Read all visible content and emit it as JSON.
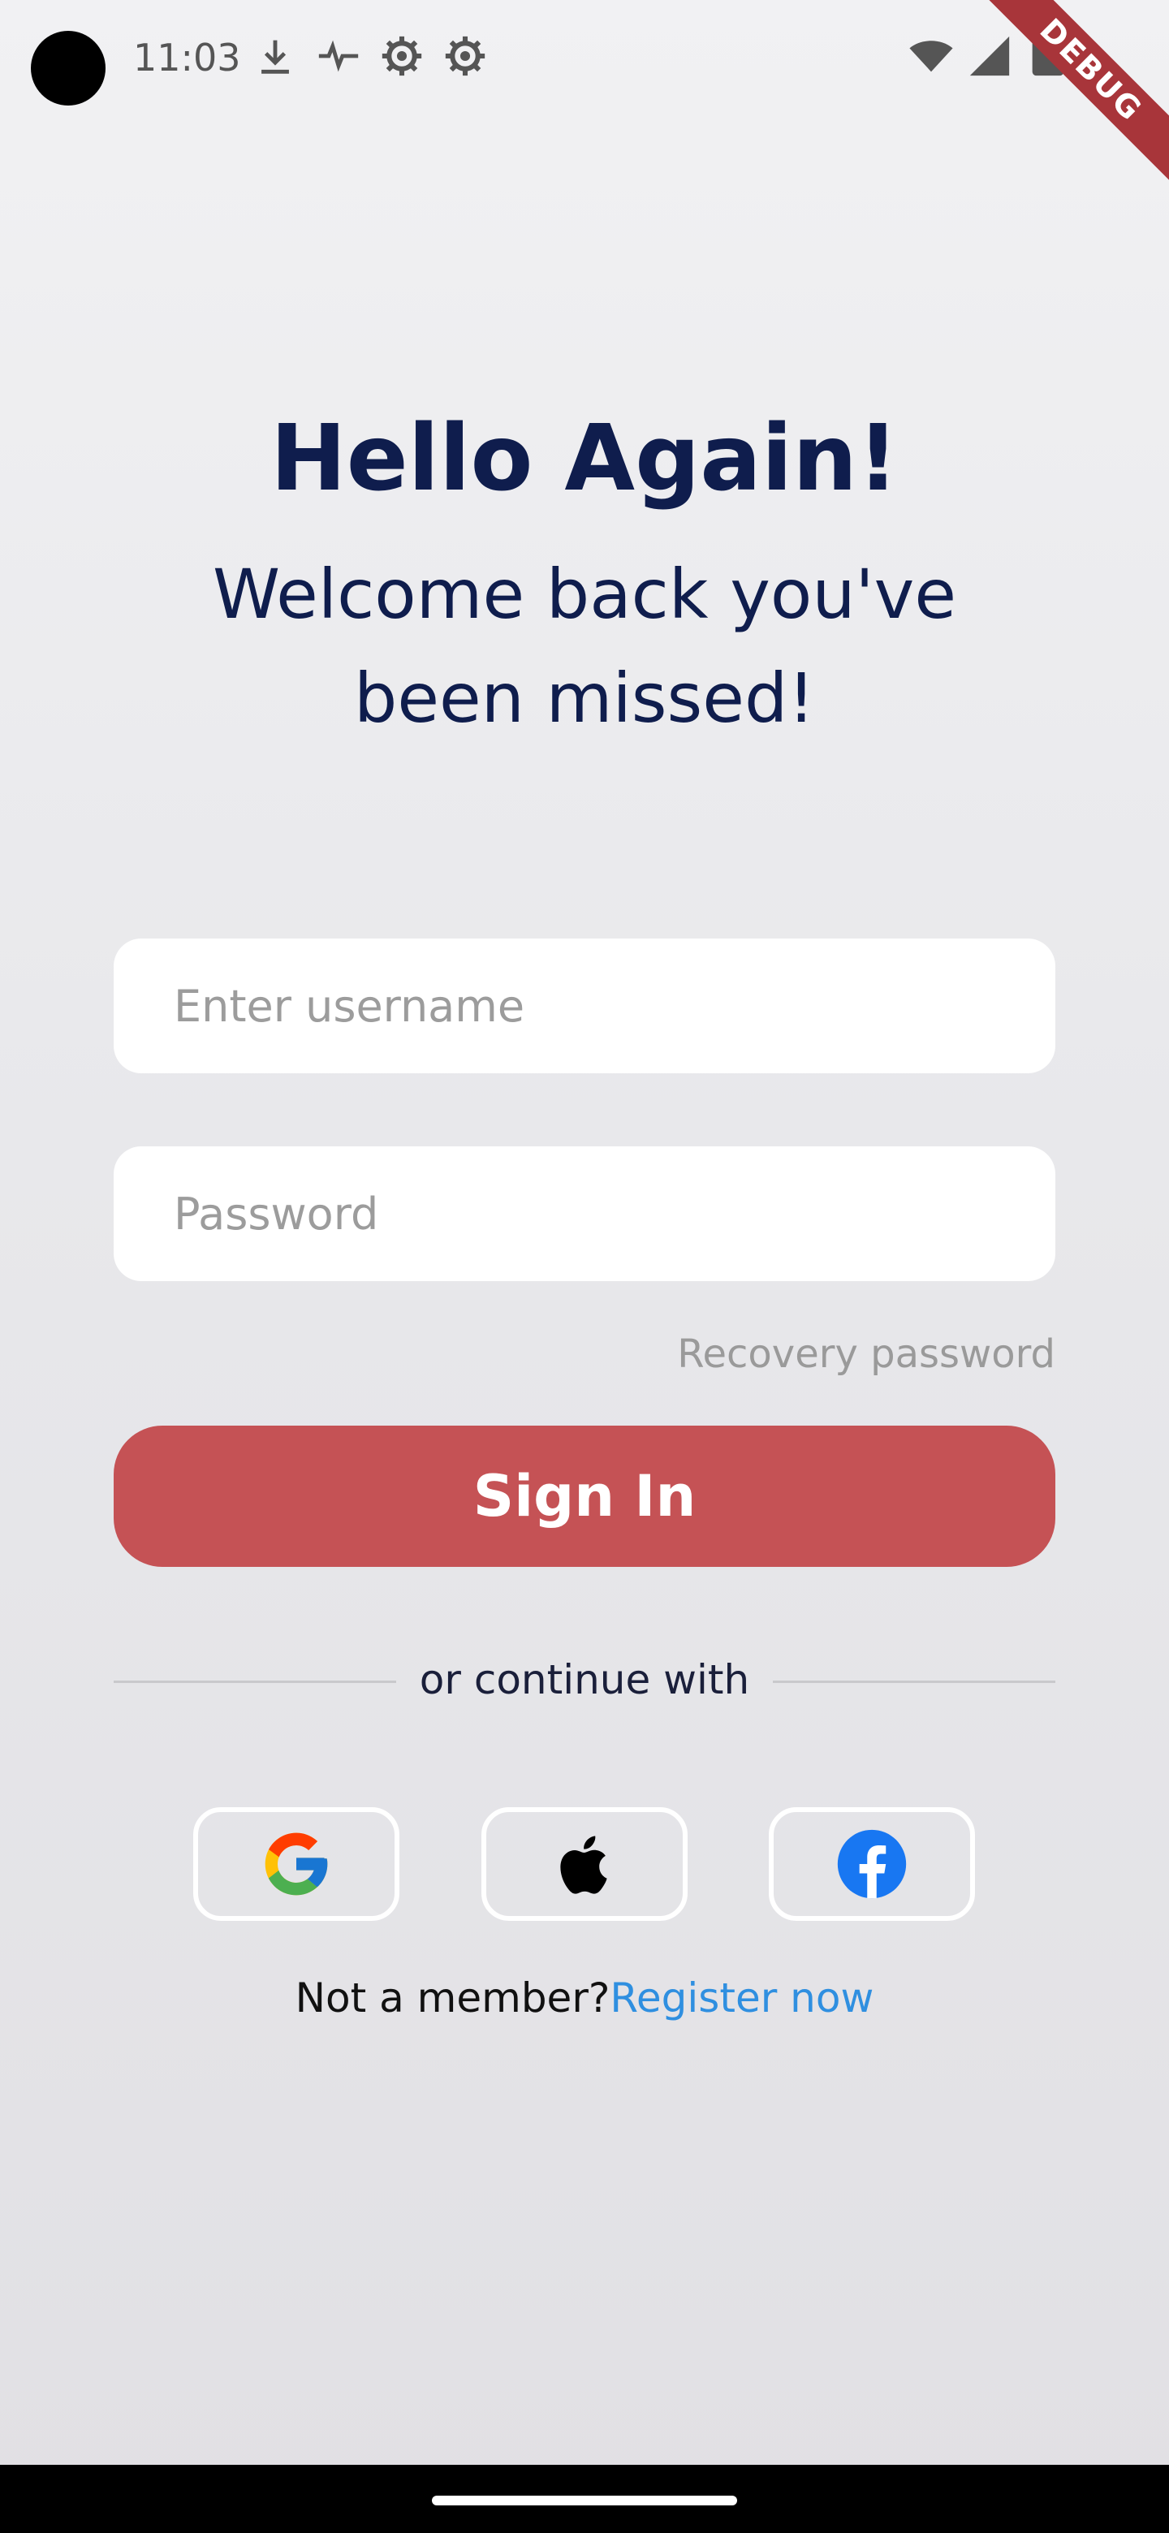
{
  "status_bar": {
    "time": "11:03",
    "left_icons": [
      "download-icon",
      "activity-icon",
      "gear-icon",
      "gear-icon"
    ],
    "right_icons": [
      "wifi-icon",
      "cellular-signal-icon",
      "battery-icon"
    ]
  },
  "debug_banner": "DEBUG",
  "header": {
    "title": "Hello Again!",
    "subtitle": "Welcome back you've been missed!"
  },
  "form": {
    "username_placeholder": "Enter username",
    "password_placeholder": "Password",
    "recovery_label": "Recovery password",
    "sign_in_label": "Sign In"
  },
  "divider_text": "or continue with",
  "social": [
    {
      "name": "Google",
      "icon": "google-icon"
    },
    {
      "name": "Apple",
      "icon": "apple-icon"
    },
    {
      "name": "Facebook",
      "icon": "facebook-icon"
    }
  ],
  "register": {
    "prompt": "Not a member?",
    "link": "Register now"
  },
  "colors": {
    "accent": "#c55255",
    "title": "#0f1d4d",
    "link": "#2f8fe0",
    "background": "#ebebee"
  }
}
